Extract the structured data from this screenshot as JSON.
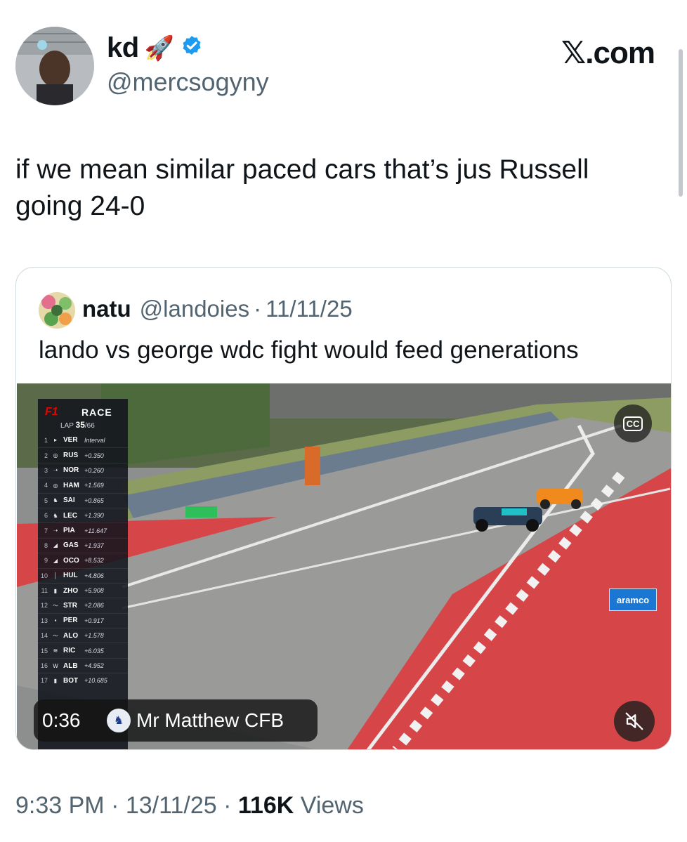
{
  "author": {
    "display_name": "kd",
    "emoji": "🚀",
    "verified_icon": "verified-badge-icon",
    "handle": "@mercsogyny"
  },
  "brand": {
    "label": "𝕏.com"
  },
  "tweet": {
    "text": "if we mean similar paced cars that’s jus Russell going 24-0"
  },
  "quoted_tweet": {
    "name": "natu",
    "handle": "@landoies",
    "separator": "·",
    "date": "11/11/25",
    "text": "lando vs george wdc fight would feed generations"
  },
  "video": {
    "timing_board": {
      "title": "RACE",
      "lap_label": "LAP",
      "lap_current": "35",
      "lap_total": "/66",
      "rows": [
        {
          "pos": "1",
          "code": "VER",
          "interval": "Interval"
        },
        {
          "pos": "2",
          "code": "RUS",
          "interval": "+0.350"
        },
        {
          "pos": "3",
          "code": "NOR",
          "interval": "+0.260"
        },
        {
          "pos": "4",
          "code": "HAM",
          "interval": "+1.569"
        },
        {
          "pos": "5",
          "code": "SAI",
          "interval": "+0.865"
        },
        {
          "pos": "6",
          "code": "LEC",
          "interval": "+1.390"
        },
        {
          "pos": "7",
          "code": "PIA",
          "interval": "+11.647"
        },
        {
          "pos": "8",
          "code": "GAS",
          "interval": "+1.937"
        },
        {
          "pos": "9",
          "code": "OCO",
          "interval": "+8.532"
        },
        {
          "pos": "10",
          "code": "HUL",
          "interval": "+4.806"
        },
        {
          "pos": "11",
          "code": "ZHO",
          "interval": "+5.908"
        },
        {
          "pos": "12",
          "code": "STR",
          "interval": "+2.086"
        },
        {
          "pos": "13",
          "code": "PER",
          "interval": "+0.917"
        },
        {
          "pos": "14",
          "code": "ALO",
          "interval": "+1.578"
        },
        {
          "pos": "15",
          "code": "RIC",
          "interval": "+6.035"
        },
        {
          "pos": "16",
          "code": "ALB",
          "interval": "+4.952"
        },
        {
          "pos": "17",
          "code": "BOT",
          "interval": "+10.685"
        }
      ]
    },
    "trackside_ad": "aramco",
    "cc_label": "CC",
    "timestamp": "0:36",
    "channel_name": "Mr Matthew CFB",
    "mute_icon": "muted-speaker-icon"
  },
  "footer": {
    "time": "9:33 PM",
    "separator": "·",
    "date": "13/11/25",
    "views_count": "116K",
    "views_label": "Views"
  }
}
